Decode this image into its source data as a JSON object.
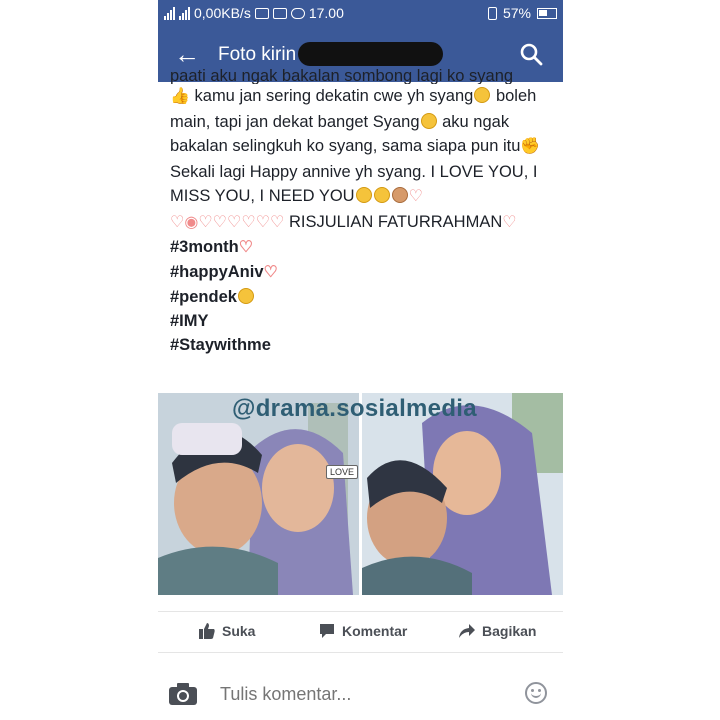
{
  "status_bar": {
    "net_speed": "0,00KB/s",
    "time": "17.00",
    "battery": "57%"
  },
  "app_bar": {
    "title": "Foto kirin",
    "back_icon": "back-arrow-icon",
    "search_icon": "search-icon"
  },
  "post": {
    "clipped_line": "paati aku ngak bakalan sombong lagi ko syang",
    "segments": {
      "s1": "kamu jan sering dekatin cwe yh syang",
      "s2": "boleh main, tapi jan dekat banget Syang",
      "s3": " aku ngak bakalan selingkuh ko syang, sama siapa pun itu",
      "s4": " Sekali lagi Happy annive yh syang. I LOVE YOU, I MISS YOU, I NEED YOU",
      "s5": " RISJULIAN FATURRAHMAN"
    },
    "hashtags": [
      "#3month",
      "#happyAniv",
      "#pendek",
      "#IMY",
      "#Staywithme"
    ]
  },
  "photos": {
    "watermark": "@drama.sosialmedia",
    "sticker": "LOVE"
  },
  "actions": {
    "like": "Suka",
    "comment": "Komentar",
    "share": "Bagikan"
  },
  "comment_box": {
    "placeholder": "Tulis komentar..."
  },
  "colors": {
    "brand_bar": "#3b5998",
    "text": "#1d2129",
    "muted": "#90949c"
  }
}
